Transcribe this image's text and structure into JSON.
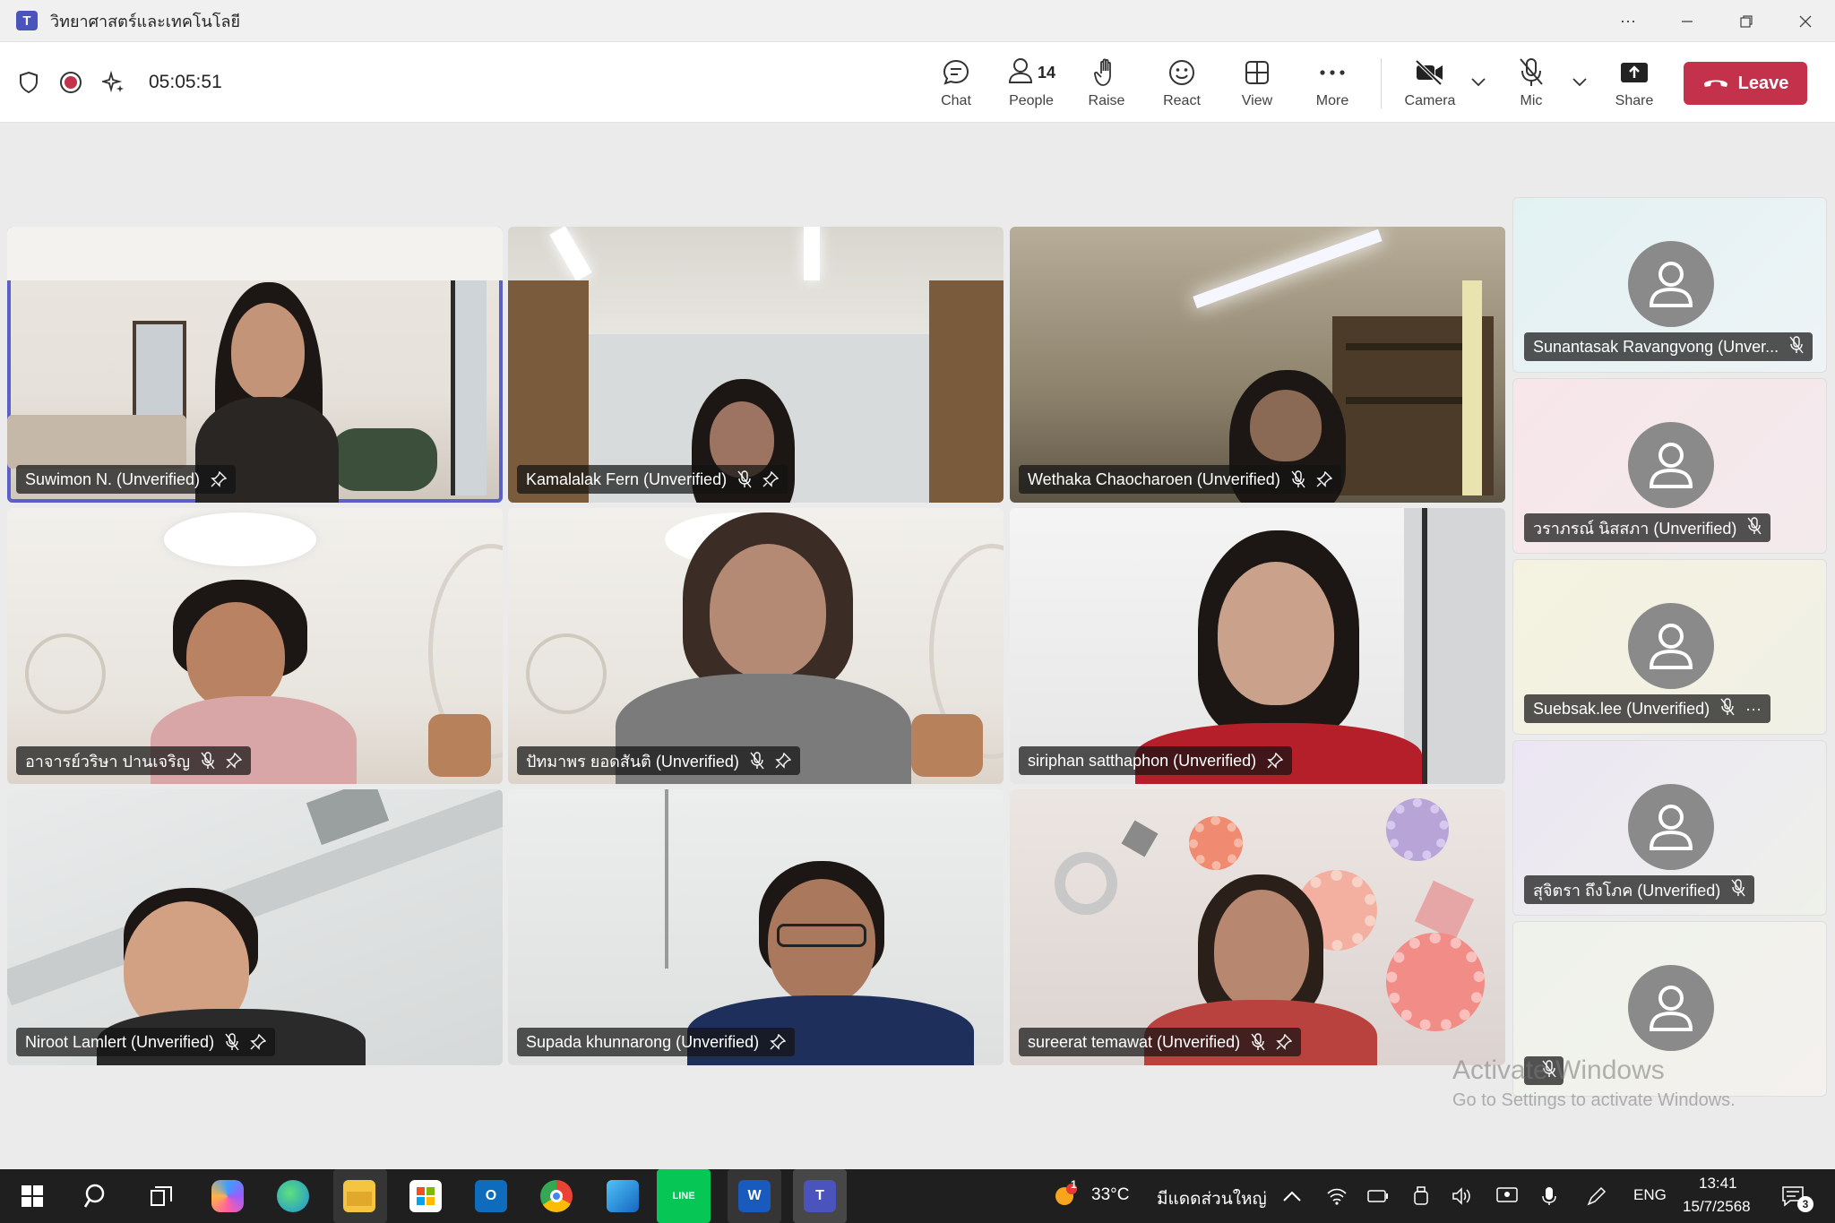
{
  "window": {
    "title": "วิทยาศาสตร์และเทคโนโลยี",
    "controls": [
      "more-icon",
      "minimize-icon",
      "restore-icon",
      "close-icon"
    ]
  },
  "toolbar": {
    "timer": "05:05:51",
    "chat_label": "Chat",
    "people_label": "People",
    "people_count": "14",
    "raise_label": "Raise",
    "react_label": "React",
    "view_label": "View",
    "more_label": "More",
    "camera_label": "Camera",
    "mic_label": "Mic",
    "share_label": "Share",
    "leave_label": "Leave",
    "leave_color": "#c4314b",
    "recording_color": "#c4314b"
  },
  "participants": [
    {
      "name": "Suwimon N. (Unverified)",
      "muted": false,
      "active_speaker": true
    },
    {
      "name": "Kamalalak Fern (Unverified)",
      "muted": true
    },
    {
      "name": "Wethaka Chaocharoen (Unverified)",
      "muted": true
    },
    {
      "name": "อาจารย์วริษา ปานเจริญ",
      "muted": true
    },
    {
      "name": "ปัทมาพร ยอดสันติ (Unverified)",
      "muted": true
    },
    {
      "name": "siriphan satthaphon (Unverified)",
      "muted": false
    },
    {
      "name": "Niroot Lamlert (Unverified)",
      "muted": true
    },
    {
      "name": "Supada khunnarong (Unverified)",
      "muted": false
    },
    {
      "name": "sureerat temawat (Unverified)",
      "muted": true
    }
  ],
  "side_participants": [
    {
      "name": "Sunantasak Ravangvong (Unver...",
      "muted": true
    },
    {
      "name": "วราภรณ์ นิสสภา (Unverified)",
      "muted": true
    },
    {
      "name": "Suebsak.lee (Unverified)",
      "muted": true,
      "has_more": true
    },
    {
      "name": "สุจิตรา ถึงโภค (Unverified)",
      "muted": true
    },
    {
      "name": "",
      "muted": true
    }
  ],
  "watermark": {
    "line1": "Activate Windows",
    "line2": "Go to Settings to activate Windows."
  },
  "taskbar": {
    "weather_temp": "33°C",
    "weather_desc": "มีแดดส่วนใหญ่",
    "weather_badge": "1",
    "language": "ENG",
    "time": "13:41",
    "date": "15/7/2568",
    "notification_count": "3",
    "apps": [
      "start-icon",
      "search-icon",
      "task-view-icon",
      "copilot-icon",
      "edge-icon",
      "file-explorer-icon",
      "store-icon",
      "outlook-icon",
      "chrome-icon",
      "photos-icon",
      "line-icon",
      "word-icon",
      "teams-icon"
    ]
  }
}
